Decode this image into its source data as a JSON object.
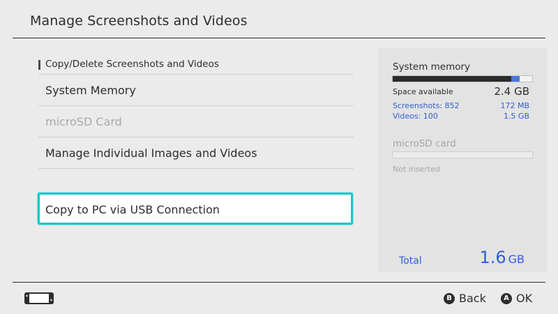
{
  "header": {
    "title": "Manage Screenshots and Videos"
  },
  "menu": {
    "section_label": "Copy/Delete Screenshots and Videos",
    "items": [
      {
        "label": "System Memory",
        "enabled": true
      },
      {
        "label": "microSD Card",
        "enabled": false
      },
      {
        "label": "Manage Individual Images and Videos",
        "enabled": true
      }
    ],
    "usb_button_label": "Copy to PC via USB Connection"
  },
  "panel": {
    "system_memory": {
      "title": "System memory",
      "usage_fraction": 0.85,
      "media_fraction": 0.06,
      "space_available_label": "Space available",
      "space_available_value": "2.4 GB",
      "screenshots_label": "Screenshots: 852",
      "screenshots_size": "172 MB",
      "videos_label": "Videos: 100",
      "videos_size": "1.5 GB"
    },
    "microsd": {
      "title": "microSD card",
      "status": "Not inserted"
    },
    "total_label": "Total",
    "total_value": "1.6",
    "total_unit": "GB"
  },
  "footer": {
    "controller_icon": "handheld-console-icon",
    "back_button_glyph": "B",
    "back_label": "Back",
    "ok_button_glyph": "A",
    "ok_label": "OK"
  },
  "colors": {
    "background": "#ebebeb",
    "panel": "#e3e3e3",
    "accent_blue": "#2f5ed8",
    "focus_cyan": "#21c5c7",
    "text": "#2d2d2d",
    "disabled_text": "#a9a9a9"
  }
}
